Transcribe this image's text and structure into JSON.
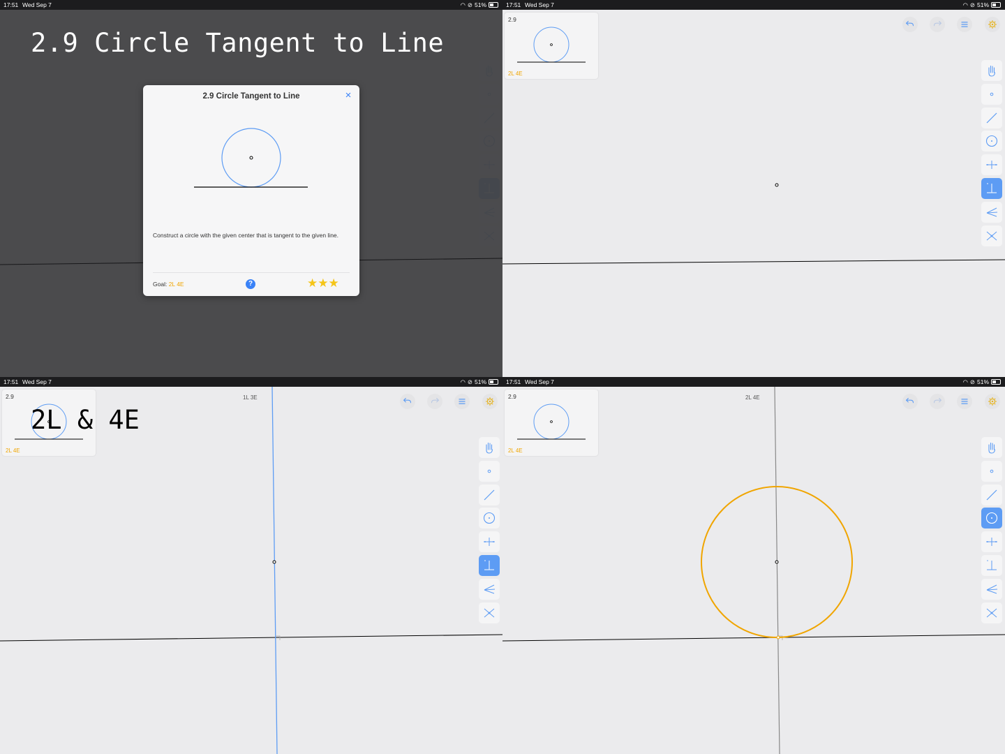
{
  "status_bar": {
    "time": "17:51",
    "date": "Wed Sep 7",
    "battery": "51%"
  },
  "overlay_title": "2.9 Circle Tangent to Line",
  "overlay_caption": "2L & 4E",
  "modal": {
    "title": "2.9 Circle Tangent to Line",
    "close_icon": "×",
    "description": "Construct a circle with the given center that is tangent to the given line.",
    "goal_label": "Goal:",
    "goal_value": "2L  4E",
    "help_label": "?",
    "stars": "★★★"
  },
  "level_thumb": {
    "number": "2.9",
    "goal": "2L  4E"
  },
  "move_counters": {
    "panel3": "1L  3E",
    "panel4": "2L  4E"
  },
  "colors": {
    "accent_blue": "#5d9cf4",
    "circle_orange": "#f0a500",
    "star_yellow": "#f5c518"
  },
  "tools": [
    "hand-icon",
    "point-icon",
    "line-icon",
    "circle-icon",
    "perpendicular-bisector-icon",
    "perpendicular-icon",
    "angle-bisector-icon",
    "intersect-icon"
  ],
  "header_buttons": [
    "undo-icon",
    "redo-icon",
    "menu-icon",
    "hint-icon"
  ]
}
